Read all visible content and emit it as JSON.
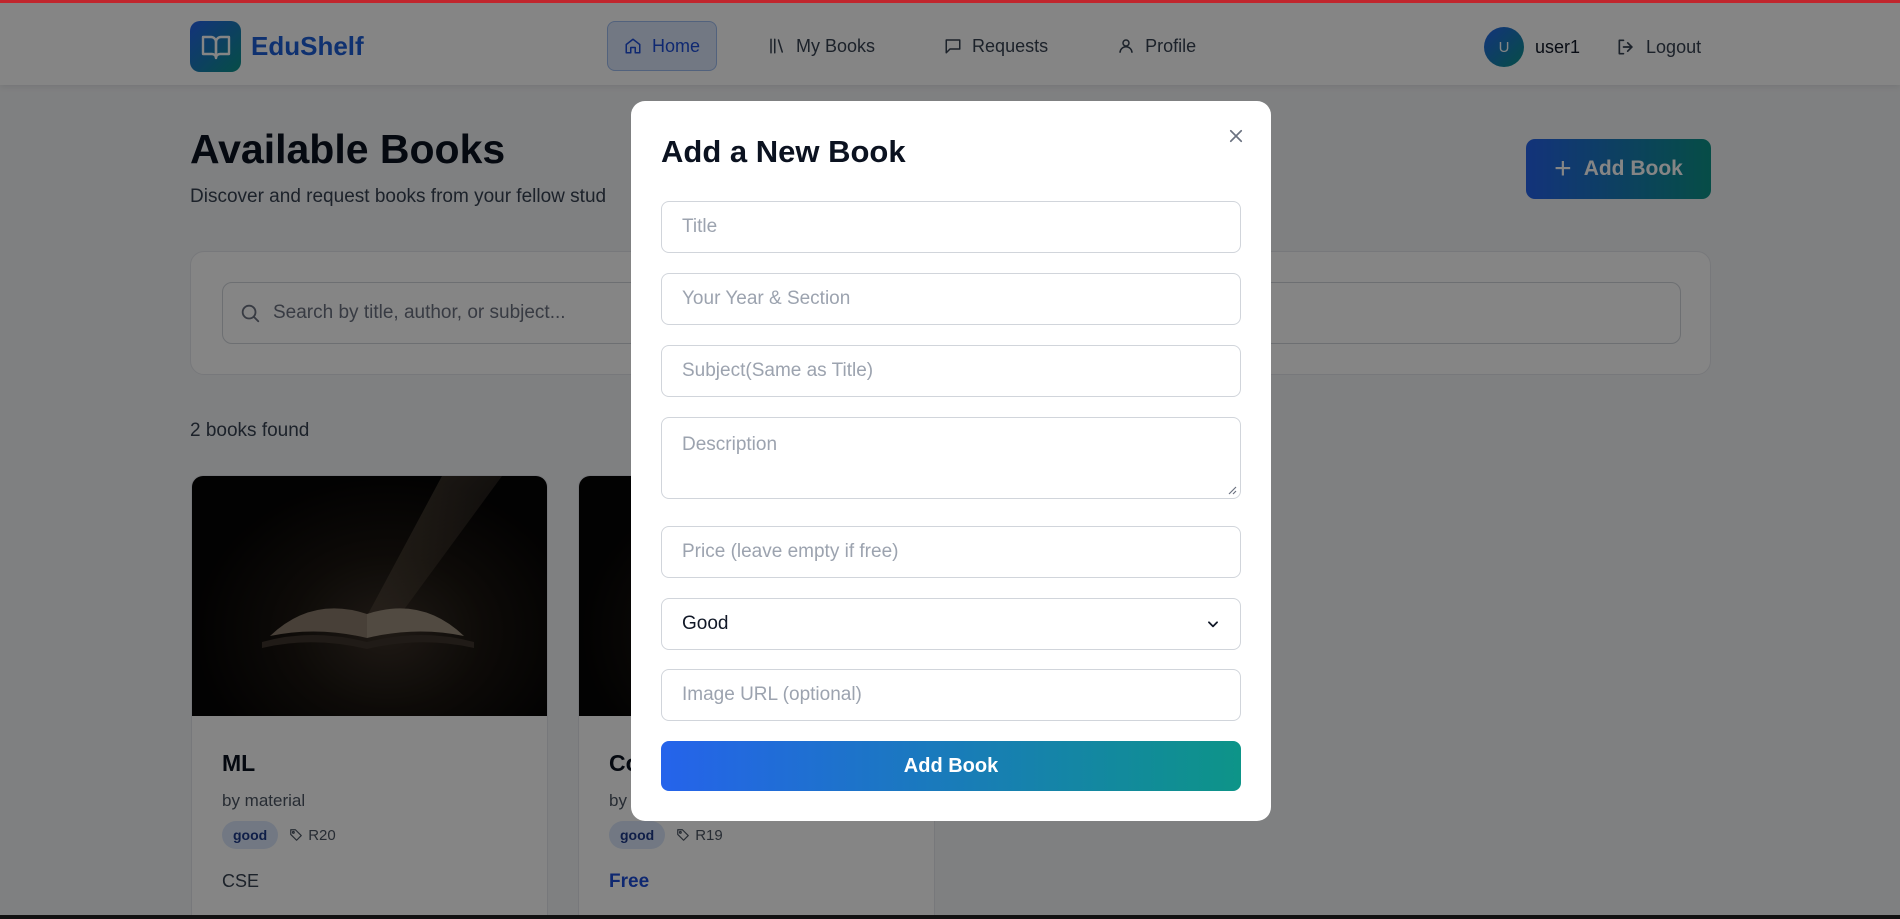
{
  "app": {
    "name": "EduShelf"
  },
  "nav": {
    "items": [
      {
        "label": "Home",
        "active": true,
        "icon": "home-icon"
      },
      {
        "label": "My Books",
        "icon": "library-icon"
      },
      {
        "label": "Requests",
        "icon": "message-icon"
      },
      {
        "label": "Profile",
        "icon": "user-icon"
      }
    ]
  },
  "user": {
    "initial": "U",
    "name": "user1",
    "logout_label": "Logout"
  },
  "page": {
    "title": "Available Books",
    "subtitle": "Discover and request books from your fellow stud",
    "add_button": "Add Book",
    "search_placeholder": "Search by title, author, or subject...",
    "count_text": "2 books found"
  },
  "books": [
    {
      "title": "ML",
      "author": "by material",
      "condition": "good",
      "regulation": "R20",
      "subject": "CSE"
    },
    {
      "title": "Co",
      "author": "by",
      "condition": "good",
      "regulation": "R19",
      "price": "Free"
    }
  ],
  "modal": {
    "title": "Add a New Book",
    "fields": {
      "title_placeholder": "Title",
      "year_section_placeholder": "Your Year & Section",
      "subject_placeholder": "Subject(Same as Title)",
      "description_placeholder": "Description",
      "price_placeholder": "Price (leave empty if free)",
      "condition_selected": "Good",
      "image_url_placeholder": "Image URL (optional)"
    },
    "submit_label": "Add Book"
  },
  "colors": {
    "brand_blue": "#2563eb",
    "brand_teal": "#0d9488",
    "accent_line": "#c0262d"
  }
}
